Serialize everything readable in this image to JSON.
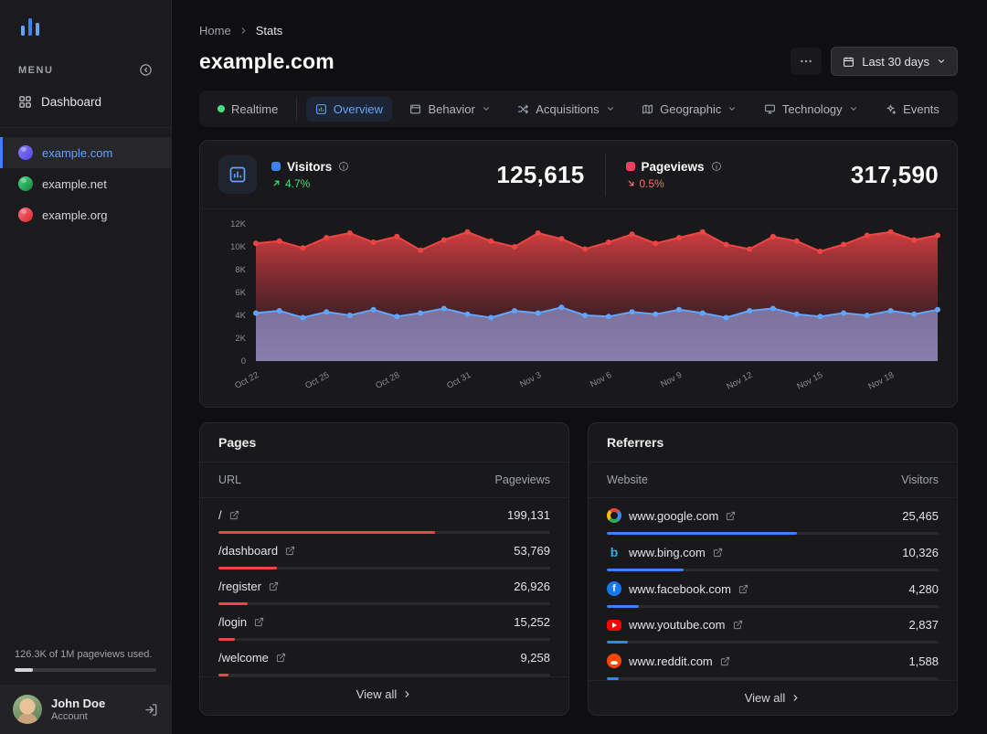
{
  "sidebar": {
    "menu_label": "MENU",
    "nav": [
      {
        "label": "Dashboard",
        "icon": "grid-icon"
      }
    ],
    "sites": [
      {
        "label": "example.com",
        "icon": "example-com-favicon",
        "color": "#6f5ff0",
        "active": true
      },
      {
        "label": "example.net",
        "icon": "example-net-favicon",
        "color": "#2fae6d",
        "active": false
      },
      {
        "label": "example.org",
        "icon": "example-org-favicon",
        "color": "#e2553f",
        "active": false
      }
    ],
    "usage": {
      "text": "126.3K of 1M pageviews used.",
      "percent": 12.6
    },
    "user": {
      "name": "John Doe",
      "role": "Account"
    }
  },
  "header": {
    "breadcrumb": [
      {
        "label": "Home"
      },
      {
        "label": "Stats"
      }
    ],
    "title": "example.com",
    "date_range": "Last 30 days"
  },
  "tabs": [
    {
      "label": "Realtime",
      "icon": "realtime-dot",
      "active": false,
      "dropdown": false
    },
    {
      "label": "Overview",
      "icon": "overview-icon",
      "active": true,
      "dropdown": false
    },
    {
      "label": "Behavior",
      "icon": "behavior-icon",
      "active": false,
      "dropdown": true
    },
    {
      "label": "Acquisitions",
      "icon": "acquisitions-icon",
      "active": false,
      "dropdown": true
    },
    {
      "label": "Geographic",
      "icon": "geographic-icon",
      "active": false,
      "dropdown": true
    },
    {
      "label": "Technology",
      "icon": "technology-icon",
      "active": false,
      "dropdown": true
    },
    {
      "label": "Events",
      "icon": "events-icon",
      "active": false,
      "dropdown": false
    }
  ],
  "stats": {
    "visitors": {
      "label": "Visitors",
      "value": "125,615",
      "change": "4.7%",
      "trend": "up",
      "color": "#3b82f6"
    },
    "pageviews": {
      "label": "Pageviews",
      "value": "317,590",
      "change": "0.5%",
      "trend": "down",
      "color": "#f43f5e"
    }
  },
  "chart_data": {
    "type": "area",
    "title": "Visitors and Pageviews over last 30 days",
    "xlabel": "",
    "ylabel": "",
    "grid": false,
    "legend_position": "none",
    "ylim": [
      0,
      12000
    ],
    "y_tick_labels": [
      "0",
      "2K",
      "4K",
      "6K",
      "8K",
      "10K",
      "12K"
    ],
    "x_tick_labels": [
      "Oct 22",
      "Oct 25",
      "Oct 28",
      "Oct 31",
      "Nov 3",
      "Nov 6",
      "Nov 9",
      "Nov 12",
      "Nov 15",
      "Nov 18"
    ],
    "x": [
      "Oct 22",
      "Oct 23",
      "Oct 24",
      "Oct 25",
      "Oct 26",
      "Oct 27",
      "Oct 28",
      "Oct 29",
      "Oct 30",
      "Oct 31",
      "Nov 1",
      "Nov 2",
      "Nov 3",
      "Nov 4",
      "Nov 5",
      "Nov 6",
      "Nov 7",
      "Nov 8",
      "Nov 9",
      "Nov 10",
      "Nov 11",
      "Nov 12",
      "Nov 13",
      "Nov 14",
      "Nov 15",
      "Nov 16",
      "Nov 17",
      "Nov 18",
      "Nov 19",
      "Nov 20"
    ],
    "series": [
      {
        "name": "Pageviews",
        "color": "#ef4444",
        "total": "317,590",
        "values": [
          10300,
          10500,
          9900,
          10800,
          11200,
          10400,
          10900,
          9700,
          10600,
          11300,
          10500,
          10000,
          11200,
          10700,
          9800,
          10400,
          11100,
          10300,
          10800,
          11300,
          10200,
          9800,
          10900,
          10500,
          9600,
          10200,
          11000,
          11300,
          10600,
          11000
        ]
      },
      {
        "name": "Visitors",
        "color": "#60a5fa",
        "total": "125,615",
        "values": [
          4200,
          4400,
          3800,
          4300,
          4000,
          4500,
          3900,
          4200,
          4600,
          4100,
          3800,
          4400,
          4200,
          4700,
          4000,
          3900,
          4300,
          4100,
          4500,
          4200,
          3800,
          4400,
          4600,
          4100,
          3900,
          4200,
          4000,
          4400,
          4100,
          4500
        ]
      }
    ]
  },
  "pages": {
    "title": "Pages",
    "columns": [
      "URL",
      "Pageviews"
    ],
    "bar_color": "#ef4444",
    "view_all": "View all",
    "rows": [
      {
        "url": "/",
        "value": "199,131"
      },
      {
        "url": "/dashboard",
        "value": "53,769"
      },
      {
        "url": "/register",
        "value": "26,926"
      },
      {
        "url": "/login",
        "value": "15,252"
      },
      {
        "url": "/welcome",
        "value": "9,258"
      }
    ]
  },
  "referrers": {
    "title": "Referrers",
    "columns": [
      "Website",
      "Visitors"
    ],
    "bar_color": "#3b82f6",
    "view_all": "View all",
    "rows": [
      {
        "site": "www.google.com",
        "icon": "google-favicon",
        "value": "25,465"
      },
      {
        "site": "www.bing.com",
        "icon": "bing-favicon",
        "value": "10,326"
      },
      {
        "site": "www.facebook.com",
        "icon": "facebook-favicon",
        "value": "4,280"
      },
      {
        "site": "www.youtube.com",
        "icon": "youtube-favicon",
        "value": "2,837"
      },
      {
        "site": "www.reddit.com",
        "icon": "reddit-favicon",
        "value": "1,588"
      }
    ]
  }
}
